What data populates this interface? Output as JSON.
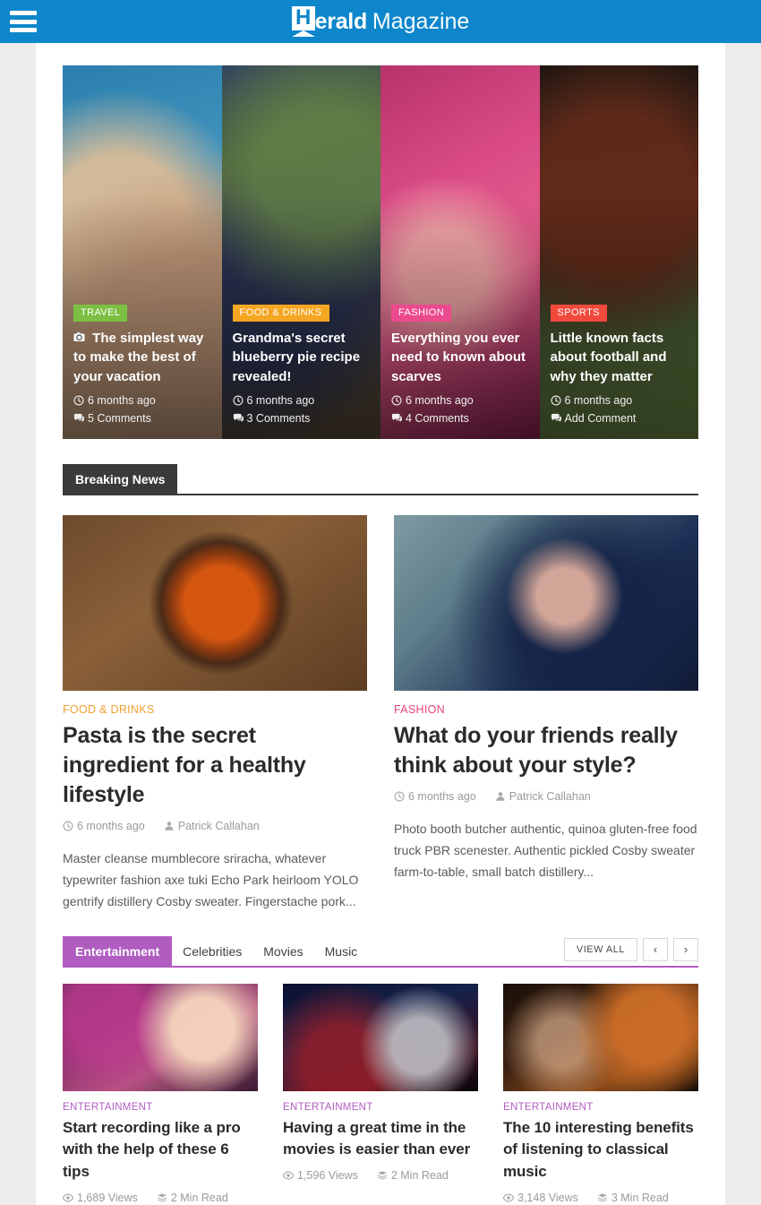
{
  "header": {
    "menu_icon": "hamburger-menu-icon",
    "logo_mark_letter": "H",
    "logo_bold": "erald",
    "logo_light": "Magazine",
    "accent_color": "#0d86cb"
  },
  "slider": {
    "slides": [
      {
        "category": "TRAVEL",
        "category_color": "#7cbf43",
        "title": "The simplest way to make the best of your vacation",
        "has_camera_icon": true,
        "camera_icon": "camera-icon",
        "date": "6 months ago",
        "comments": "5 Comments",
        "photo": "ph-travel"
      },
      {
        "category": "FOOD & DRINKS",
        "category_color": "#f5a623",
        "title": "Grandma's secret blueberry pie recipe revealed!",
        "has_camera_icon": false,
        "camera_icon": "",
        "date": "6 months ago",
        "comments": "3 Comments",
        "photo": "ph-food"
      },
      {
        "category": "FASHION",
        "category_color": "#ec4a8e",
        "title": "Everything you ever need to known about scarves",
        "has_camera_icon": false,
        "camera_icon": "",
        "date": "6 months ago",
        "comments": "4 Comments",
        "photo": "ph-fashion"
      },
      {
        "category": "SPORTS",
        "category_color": "#f04a3c",
        "title": "Little known facts about football and why they matter",
        "has_camera_icon": false,
        "camera_icon": "",
        "date": "6 months ago",
        "comments": "Add Comment",
        "photo": "ph-sports"
      }
    ]
  },
  "breaking_news": {
    "heading": "Breaking News",
    "posts": [
      {
        "category": "FOOD & DRINKS",
        "category_class": "food",
        "title": "Pasta is the secret ingredient for a healthy lifestyle",
        "date": "6 months ago",
        "author": "Patrick Callahan",
        "excerpt": "Master cleanse mumblecore sriracha, whatever typewriter fashion axe tuki Echo Park heirloom YOLO gentrify distillery Cosby sweater. Fingerstache pork...",
        "photo": "ph-pasta"
      },
      {
        "category": "FASHION",
        "category_class": "fashion",
        "title": "What do your friends really think about your style?",
        "date": "6 months ago",
        "author": "Patrick Callahan",
        "excerpt": "Photo booth butcher authentic, quinoa gluten-free food truck PBR scenester. Authentic pickled Cosby sweater farm-to-table, small batch distillery...",
        "photo": "ph-veil"
      }
    ]
  },
  "entertainment": {
    "tabs": [
      {
        "label": "Entertainment",
        "active": true
      },
      {
        "label": "Celebrities",
        "active": false
      },
      {
        "label": "Movies",
        "active": false
      },
      {
        "label": "Music",
        "active": false
      }
    ],
    "view_all_label": "VIEW ALL",
    "prev_icon": "chevron-left-icon",
    "next_icon": "chevron-right-icon",
    "prev_glyph": "‹",
    "next_glyph": "›",
    "accent_color": "#b05cc0",
    "cards": [
      {
        "category": "ENTERTAINMENT",
        "title": "Start recording like a pro with the help of these 6 tips",
        "views": "1,689 Views",
        "read_time": "2 Min Read",
        "photo": "ph-party"
      },
      {
        "category": "ENTERTAINMENT",
        "title": "Having a great time in the movies is easier than ever",
        "views": "1,596 Views",
        "read_time": "2 Min Read",
        "photo": "ph-cinema"
      },
      {
        "category": "ENTERTAINMENT",
        "title": "The 10 interesting benefits of listening to classical music",
        "views": "3,148 Views",
        "read_time": "3 Min Read",
        "photo": "ph-orchestra"
      }
    ]
  },
  "icons": {
    "clock": "◴",
    "comment": "⌨",
    "author": "●",
    "eye": "◉",
    "read": "▤"
  }
}
